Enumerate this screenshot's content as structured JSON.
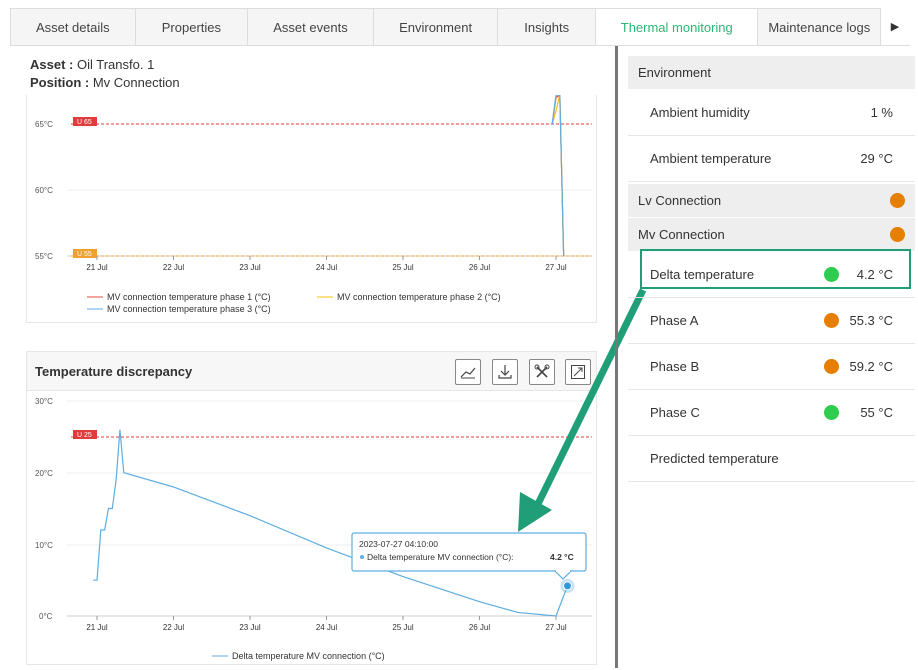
{
  "tabs": [
    {
      "label": "Asset details"
    },
    {
      "label": "Properties"
    },
    {
      "label": "Asset events"
    },
    {
      "label": "Environment"
    },
    {
      "label": "Insights"
    },
    {
      "label": "Thermal monitoring",
      "active": true
    },
    {
      "label": "Maintenance logs"
    }
  ],
  "asset": {
    "asset_label": "Asset :",
    "asset_value": "Oil Transfo. 1",
    "position_label": "Position :",
    "position_value": "Mv Connection"
  },
  "chart_top": {
    "yticks": [
      "65°C",
      "60°C",
      "55°C"
    ],
    "xticks": [
      "21 Jul",
      "22 Jul",
      "23 Jul",
      "24 Jul",
      "25 Jul",
      "26 Jul",
      "27 Jul"
    ],
    "thresholds": [
      {
        "label": "U 65",
        "color": "#e03c3c"
      },
      {
        "label": "U 55",
        "color": "#f0a030"
      }
    ],
    "legend": [
      {
        "name": "MV connection temperature phase 1 (°C)",
        "color": "#e74c3c"
      },
      {
        "name": "MV connection temperature phase 2 (°C)",
        "color": "#f1c40f"
      },
      {
        "name": "MV connection temperature phase 3 (°C)",
        "color": "#5dade2"
      }
    ]
  },
  "chart_bottom": {
    "title": "Temperature discrepancy",
    "yticks": [
      "30°C",
      "20°C",
      "10°C",
      "0°C"
    ],
    "xticks": [
      "21 Jul",
      "22 Jul",
      "23 Jul",
      "24 Jul",
      "25 Jul",
      "26 Jul",
      "27 Jul"
    ],
    "threshold": {
      "label": "U 25",
      "color": "#e03c3c"
    },
    "legend": "Delta temperature MV connection (°C)",
    "tooltip": {
      "date": "2023-07-27 04:10:00",
      "series": "Delta temperature MV connection (°C):",
      "value": "4.2 °C"
    }
  },
  "chart_data": [
    {
      "type": "line",
      "x": [
        "21 Jul",
        "22 Jul",
        "23 Jul",
        "24 Jul",
        "25 Jul",
        "26 Jul",
        "27 Jul"
      ],
      "ylim": [
        55,
        70
      ],
      "thresholds": [
        65,
        55
      ],
      "series": [
        {
          "name": "MV connection temperature phase 1 (°C)",
          "points": [
            [
              6.95,
              65
            ],
            [
              7.0,
              67
            ],
            [
              7.05,
              70
            ],
            [
              7.1,
              55
            ]
          ]
        },
        {
          "name": "MV connection temperature phase 2 (°C)",
          "points": [
            [
              6.95,
              65
            ],
            [
              7.0,
              66
            ],
            [
              7.05,
              70
            ],
            [
              7.1,
              55
            ]
          ]
        },
        {
          "name": "MV connection temperature phase 3 (°C)",
          "points": [
            [
              6.95,
              65
            ],
            [
              7.0,
              68
            ],
            [
              7.05,
              70
            ],
            [
              7.1,
              55
            ]
          ]
        }
      ]
    },
    {
      "type": "line",
      "title": "Temperature discrepancy",
      "x": [
        "21 Jul",
        "22 Jul",
        "23 Jul",
        "24 Jul",
        "25 Jul",
        "26 Jul",
        "27 Jul"
      ],
      "ylim": [
        0,
        30
      ],
      "threshold": 25,
      "series": [
        {
          "name": "Delta temperature MV connection (°C)",
          "points": [
            [
              0.95,
              5
            ],
            [
              1.0,
              5
            ],
            [
              1.05,
              12
            ],
            [
              1.1,
              12
            ],
            [
              1.15,
              15
            ],
            [
              1.2,
              15
            ],
            [
              1.25,
              19
            ],
            [
              1.3,
              26
            ],
            [
              1.35,
              20
            ],
            [
              2,
              18
            ],
            [
              3,
              14
            ],
            [
              4,
              9.5
            ],
            [
              5,
              5.5
            ],
            [
              6,
              2
            ],
            [
              6.5,
              0.5
            ],
            [
              7,
              0
            ],
            [
              7.15,
              4.2
            ]
          ]
        }
      ]
    }
  ],
  "right_panel": {
    "env_header": "Environment",
    "env_rows": [
      {
        "label": "Ambient humidity",
        "value": "1 %"
      },
      {
        "label": "Ambient temperature",
        "value": "29 °C"
      }
    ],
    "lv_header": "Lv Connection",
    "mv_header": "Mv Connection",
    "mv_rows": [
      {
        "label": "Delta temperature",
        "value": "4.2 °C",
        "status": "green"
      },
      {
        "label": "Phase A",
        "value": "55.3 °C",
        "status": "orange"
      },
      {
        "label": "Phase B",
        "value": "59.2 °C",
        "status": "orange"
      },
      {
        "label": "Phase C",
        "value": "55 °C",
        "status": "green"
      },
      {
        "label": "Predicted temperature",
        "value": ""
      }
    ]
  },
  "colors": {
    "accent": "#2bb673",
    "annotation": "#1f9e78",
    "orange": "#e67e00",
    "green": "#2ecc4f",
    "line": "#5dade2"
  }
}
